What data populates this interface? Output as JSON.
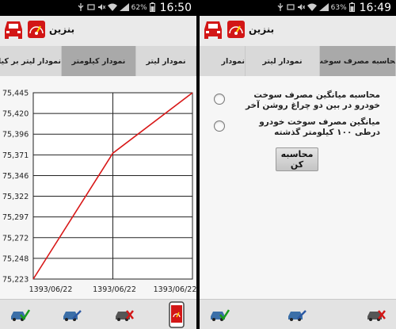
{
  "left": {
    "status": {
      "battery": "62%",
      "time": "16:50"
    },
    "app_title": "بنزین",
    "tabs": [
      "نمودار لیتر بر کیلومتر",
      "نمودار کیلومتر",
      "نمودار لیتر"
    ],
    "active_tab": 1
  },
  "right": {
    "status": {
      "battery": "63%",
      "time": "16:49"
    },
    "app_title": "بنزین",
    "tabs": [
      "نمودار",
      "نمودار لیتر",
      "محاسبه مصرف سوخت"
    ],
    "active_tab": 2,
    "options": [
      "محاسبه میانگین مصرف سوخت خودرو در بین دو چراغ روشن آخر",
      "میانگین مصرف سوخت خودرو درطی ۱۰۰ کیلومتر گذشته"
    ],
    "calc_button": "محاسبه کن"
  },
  "colors": {
    "line": "#d81818",
    "grid": "#222222",
    "active_tab": "#a9a9a9"
  },
  "chart_data": {
    "type": "line",
    "title": "",
    "xlabel": "",
    "ylabel": "",
    "x": [
      "1393/06/22",
      "1393/06/22",
      "1393/06/22"
    ],
    "y_ticks": [
      "75,445",
      "75,420",
      "75,396",
      "75,371",
      "75,346",
      "75,322",
      "75,297",
      "75,272",
      "75,248",
      "75,223"
    ],
    "ylim": [
      75223,
      75445
    ],
    "series": [
      {
        "values": [
          75223,
          75373,
          75445
        ]
      }
    ],
    "grid": true
  }
}
